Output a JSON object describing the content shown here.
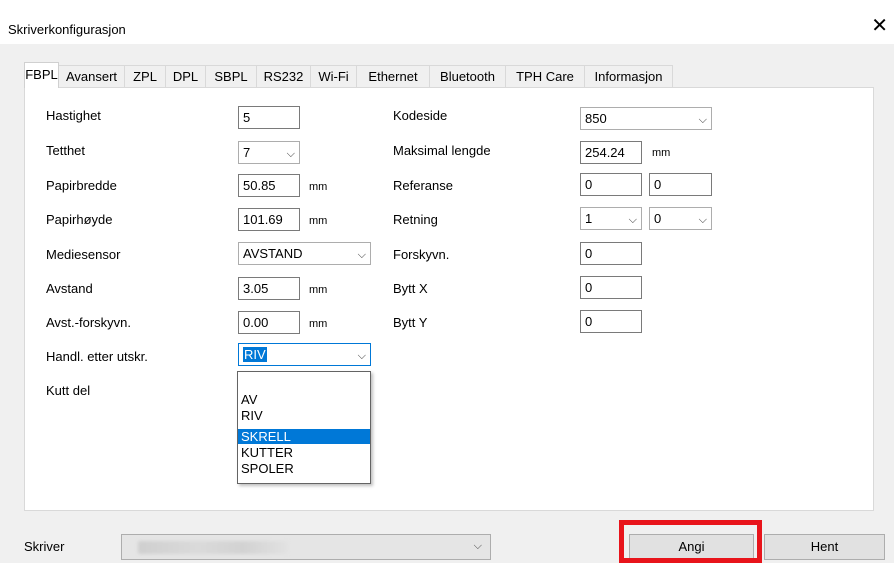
{
  "window": {
    "title": "Skriverkonfigurasjon",
    "close_glyph": "✕"
  },
  "tabs": [
    {
      "label": "FBPL",
      "active": true
    },
    {
      "label": "Avansert"
    },
    {
      "label": "ZPL"
    },
    {
      "label": "DPL"
    },
    {
      "label": "SBPL"
    },
    {
      "label": "RS232"
    },
    {
      "label": "Wi-Fi"
    },
    {
      "label": "Ethernet"
    },
    {
      "label": "Bluetooth"
    },
    {
      "label": "TPH Care"
    },
    {
      "label": "Informasjon"
    }
  ],
  "left": {
    "hastighet": {
      "label": "Hastighet",
      "value": "5"
    },
    "tetthet": {
      "label": "Tetthet",
      "value": "7"
    },
    "papirbredde": {
      "label": "Papirbredde",
      "value": "50.85",
      "unit": "mm"
    },
    "papirhoyde": {
      "label": "Papirhøyde",
      "value": "101.69",
      "unit": "mm"
    },
    "mediesensor": {
      "label": "Mediesensor",
      "value": "AVSTAND"
    },
    "avstand": {
      "label": "Avstand",
      "value": "3.05",
      "unit": "mm"
    },
    "avst_forskyvn": {
      "label": "Avst.-forskyvn.",
      "value": "0.00",
      "unit": "mm"
    },
    "handl": {
      "label": "Handl. etter utskr.",
      "value": "RIV"
    },
    "kutt": {
      "label": "Kutt del"
    }
  },
  "right": {
    "kodeside": {
      "label": "Kodeside",
      "value": "850"
    },
    "maks_lengde": {
      "label": "Maksimal lengde",
      "value": "254.24",
      "unit": "mm"
    },
    "referanse": {
      "label": "Referanse",
      "x": "0",
      "y": "0"
    },
    "retning": {
      "label": "Retning",
      "a": "1",
      "b": "0"
    },
    "forskyvn": {
      "label": "Forskyvn.",
      "value": "0"
    },
    "bytt_x": {
      "label": "Bytt X",
      "value": "0"
    },
    "bytt_y": {
      "label": "Bytt Y",
      "value": "0"
    }
  },
  "dropdown": {
    "options": [
      "",
      "AV",
      "RIV",
      "SKRELL",
      "KUTTER",
      "SPOLER"
    ],
    "highlighted": "SKRELL"
  },
  "footer": {
    "printer_label": "Skriver",
    "apply_label": "Angi",
    "fetch_label": "Hent"
  },
  "colors": {
    "accent": "#0078d7",
    "highlight_box": "#e8141b"
  }
}
